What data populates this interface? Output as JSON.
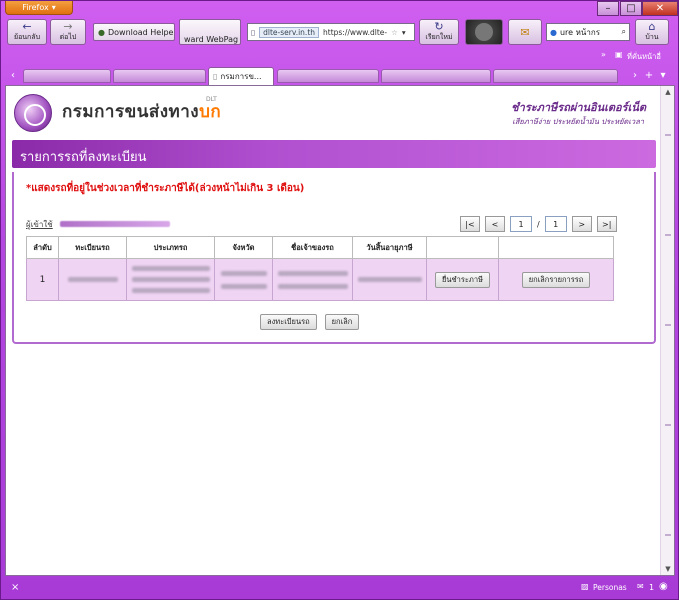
{
  "browser": {
    "app_button": "Firefox",
    "window_controls": [
      "–",
      "□",
      "✕"
    ],
    "back_label": "ย้อนกลับ",
    "forward_label": "ต่อไป",
    "download_helper": "Download Helper",
    "webpage_btn": "ward WebPag",
    "url_site": "dlte-serv.in.th",
    "url_text": "https://www.dlte-",
    "reload_label": "เรียกใหม่",
    "search_text": "ure หน้ากร",
    "home_label": "บ้าน",
    "bookmarks_label": "ที่คั่นหน้าอื่",
    "active_tab_title": "กรมการข..."
  },
  "page": {
    "dept_name_main": "กรมการขนส่งทาง",
    "dept_name_accent": "บก",
    "dept_abbr": "DLT",
    "pay_title": "ชำระภาษีรถผ่านอินเตอร์เน็ต",
    "pay_subtitle": "เสียภาษีง่าย ประหยัดน้ำมัน ประหยัดเวลา",
    "section_title": "รายการรถที่ลงทะเบียน",
    "notice_text": "*แสดงรถที่อยู่ในช่วงเวลาที่ชำระภาษีได้(ล่วงหน้าไม่เกิน 3 เดือน)",
    "user_label": "ผู้เข้าใช้",
    "pager": {
      "first": "|<",
      "prev": "<",
      "current_page": "1",
      "sep": "/",
      "total_pages": "1",
      "next": ">",
      "last": ">|"
    },
    "table": {
      "headers": [
        "ลำดับ",
        "ทะเบียนรถ",
        "ประเภทรถ",
        "จังหวัด",
        "ชื่อเจ้าของรถ",
        "วันสิ้นอายุภาษี",
        "",
        ""
      ],
      "rows": [
        {
          "index": "1",
          "pay_btn": "ยื่นชำระภาษี",
          "cancel_btn": "ยกเลิกรายการรถ"
        }
      ]
    },
    "register_btn": "ลงทะเบียนรถ",
    "cancel_btn": "ยกเลิก"
  },
  "status": {
    "close_x": "×",
    "persona": "Personas",
    "mail_count": "1"
  }
}
